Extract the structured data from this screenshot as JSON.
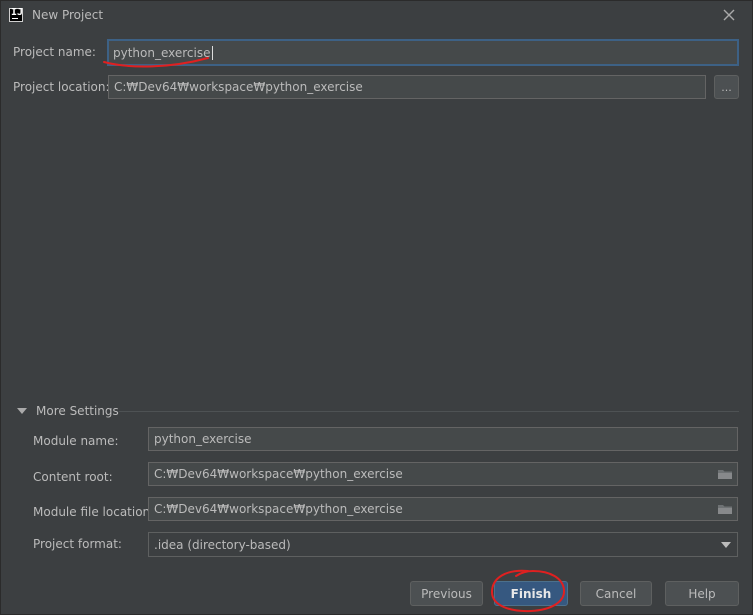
{
  "window": {
    "title": "New Project"
  },
  "project": {
    "name_label": "Project name:",
    "name_value": "python_exercise",
    "location_label": "Project location:",
    "location_value": "C:₩Dev64₩workspace₩python_exercise",
    "browse_label": "..."
  },
  "more_settings": {
    "label": "More Settings",
    "module_name_label": "Module name:",
    "module_name_value": "python_exercise",
    "content_root_label": "Content root:",
    "content_root_value": "C:₩Dev64₩workspace₩python_exercise",
    "module_file_label": "Module file location:",
    "module_file_value": "C:₩Dev64₩workspace₩python_exercise",
    "format_label": "Project format:",
    "format_value": ".idea (directory-based)"
  },
  "buttons": {
    "previous": "Previous",
    "finish": "Finish",
    "cancel": "Cancel",
    "help": "Help"
  },
  "colors": {
    "background": "#3c3f41",
    "field_background": "#45494a",
    "focus_border": "#3d6185",
    "primary_button": "#365880",
    "annotation_red": "#e02020"
  },
  "icons": {
    "app": "intellij-icon",
    "close": "close-icon",
    "folder": "folder-icon",
    "chevron": "chevron-down-icon"
  }
}
